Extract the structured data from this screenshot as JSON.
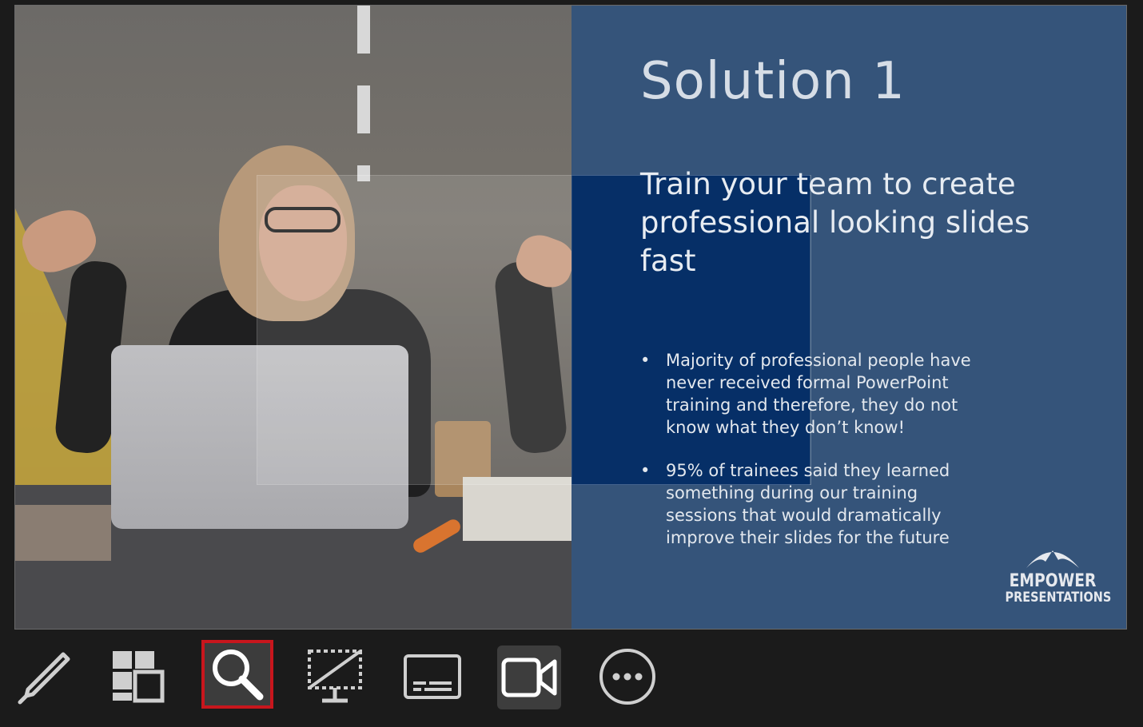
{
  "slide": {
    "title": "Solution 1",
    "subtitle": "Train your team to create professional looking slides fast",
    "bullets": [
      "Majority of professional people have never received formal PowerPoint training and therefore, they do not know what they don’t know!",
      "95% of trainees said they learned something during our training sessions that would dramatically improve their slides for the future"
    ],
    "logo": {
      "line1": "EMPOWER",
      "line2": "PRESENTATIONS"
    }
  },
  "toolbar": {
    "items": [
      {
        "name": "pen-tool",
        "icon": "pen-icon",
        "active": false
      },
      {
        "name": "see-all-slides",
        "icon": "slides-grid-icon",
        "active": false
      },
      {
        "name": "zoom",
        "icon": "magnifier-icon",
        "active": true,
        "highlight": "#c8161d"
      },
      {
        "name": "black-screen",
        "icon": "monitor-off-icon",
        "active": false
      },
      {
        "name": "subtitles",
        "icon": "subtitles-icon",
        "active": false
      },
      {
        "name": "camera",
        "icon": "video-camera-icon",
        "active": true
      },
      {
        "name": "more-options",
        "icon": "more-ellipsis-icon",
        "active": false
      }
    ]
  },
  "colors": {
    "background": "#1b1b1b",
    "panel": "#34547a",
    "zoom_tint": "#06316a",
    "highlight": "#c8161d"
  }
}
